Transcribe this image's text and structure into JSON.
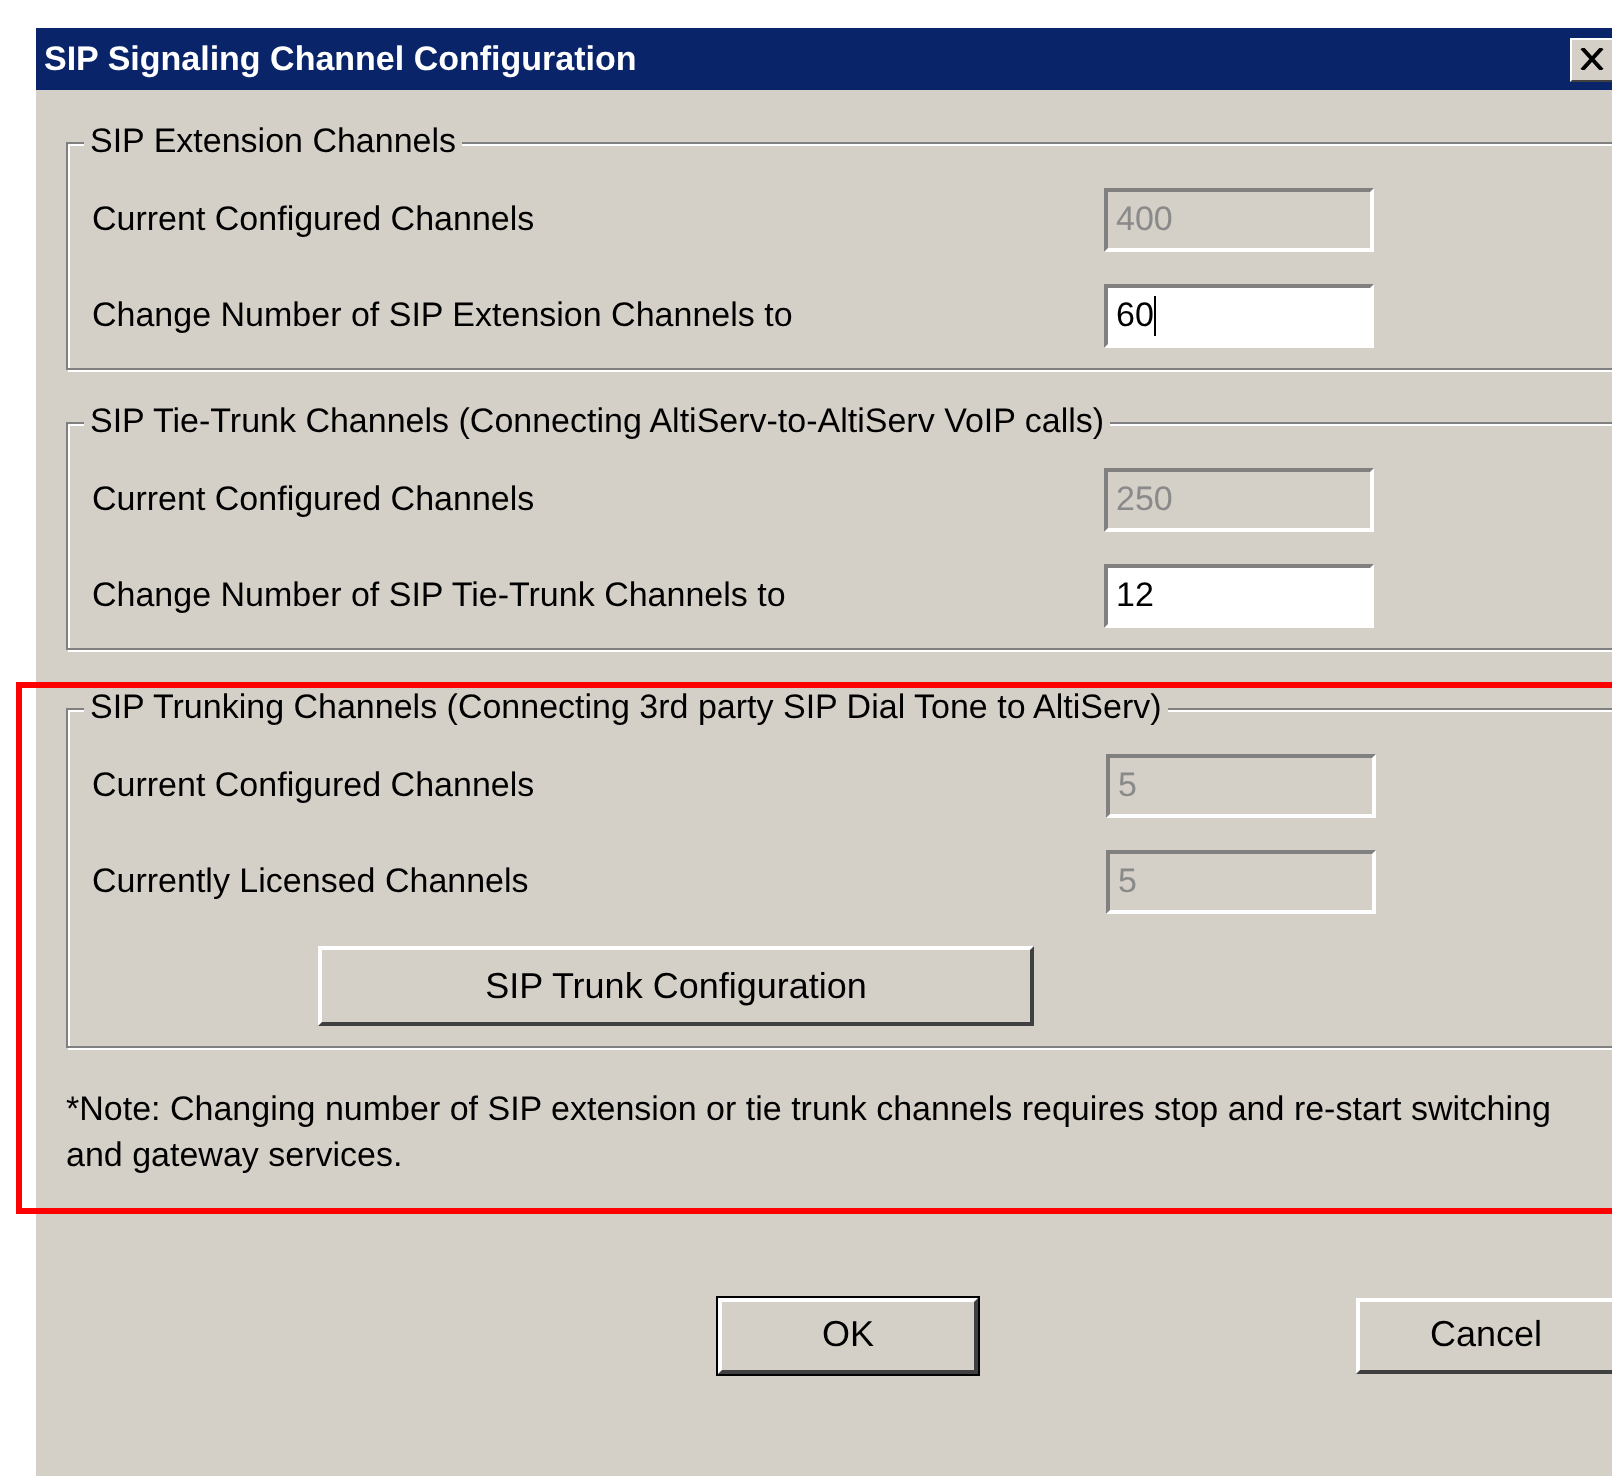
{
  "window": {
    "title": "SIP Signaling Channel Configuration"
  },
  "groups": [
    {
      "title": "SIP Extension Channels",
      "highlighted": false,
      "fields": [
        {
          "label": "Current Configured Channels",
          "value": "400",
          "disabled": true,
          "focused": false
        },
        {
          "label": "Change Number of SIP Extension Channels to",
          "value": "60",
          "disabled": false,
          "focused": true
        }
      ]
    },
    {
      "title": "SIP Tie-Trunk Channels (Connecting AltiServ-to-AltiServ VoIP calls)",
      "highlighted": false,
      "fields": [
        {
          "label": "Current Configured Channels",
          "value": "250",
          "disabled": true,
          "focused": false
        },
        {
          "label": "Change Number of SIP Tie-Trunk Channels to",
          "value": "12",
          "disabled": false,
          "focused": false
        }
      ]
    },
    {
      "title": "SIP Trunking Channels (Connecting 3rd party SIP Dial Tone to AltiServ)",
      "highlighted": true,
      "fields": [
        {
          "label": "Current Configured Channels",
          "value": "5",
          "disabled": true,
          "focused": false
        },
        {
          "label": "Currently Licensed Channels",
          "value": "5",
          "disabled": true,
          "focused": false
        }
      ],
      "button": "SIP Trunk Configuration"
    }
  ],
  "note": "*Note: Changing number of SIP extension or tie trunk channels requires stop and re-start switching and gateway services.",
  "buttons": [
    {
      "label": "OK",
      "default": true
    },
    {
      "label": "Cancel",
      "default": false
    }
  ]
}
